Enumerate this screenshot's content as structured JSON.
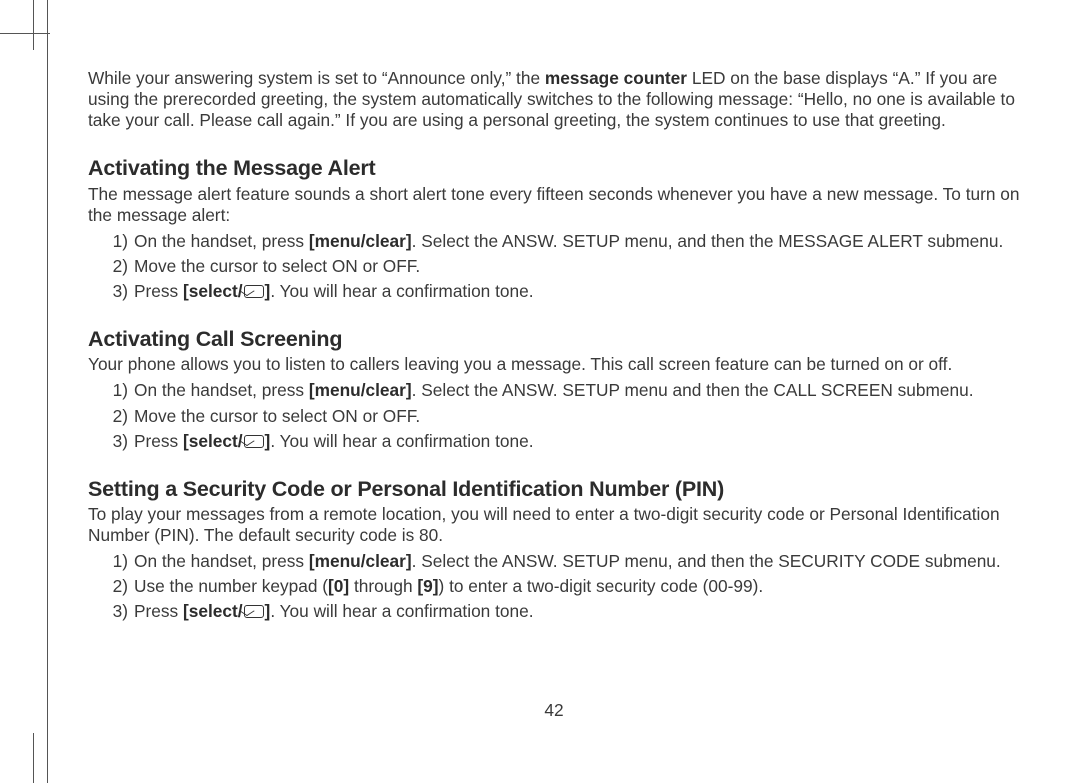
{
  "intro": {
    "p1_a": "While your answering system is set to “Announce only,” the ",
    "p1_bold": "message counter",
    "p1_b": " LED on the base displays “A.” If you are using the prerecorded greeting, the system automatically switches to the following message: “Hello, no one is available to take your call. Please call again.” If you are using a personal greeting, the system continues to use that greeting."
  },
  "sec1": {
    "heading": "Activating the Message Alert",
    "p": "The message alert feature sounds a short alert tone every fifteen seconds whenever you have a new message. To turn on the message alert:",
    "steps": [
      {
        "n": "1)",
        "a": "On the handset, press ",
        "b": "[menu/clear]",
        "c": ". Select the ANSW. SETUP menu, and then the MESSAGE ALERT submenu."
      },
      {
        "n": "2)",
        "a": "Move the cursor to select ON or OFF.",
        "b": "",
        "c": ""
      },
      {
        "n": "3)",
        "a": "Press ",
        "b": "[select/",
        "c": "]",
        "d": ". You will hear a confirmation tone."
      }
    ]
  },
  "sec2": {
    "heading": "Activating Call Screening",
    "p": "Your phone allows you to listen to callers leaving you a message. This call screen feature can be turned on or off.",
    "steps": [
      {
        "n": "1)",
        "a": "On the handset, press ",
        "b": "[menu/clear]",
        "c": ". Select the ANSW. SETUP menu and then the CALL SCREEN submenu."
      },
      {
        "n": "2)",
        "a": "Move the cursor to select ON or OFF.",
        "b": "",
        "c": ""
      },
      {
        "n": "3)",
        "a": "Press ",
        "b": "[select/",
        "c": "]",
        "d": ". You will hear a confirmation tone."
      }
    ]
  },
  "sec3": {
    "heading": "Setting a Security Code or Personal Identification Number (PIN)",
    "p": "To play your messages from a remote location, you will need to enter a two-digit security code or Personal Identification Number (PIN). The default security code is 80.",
    "steps": [
      {
        "n": "1)",
        "a": "On the handset, press ",
        "b": "[menu/clear]",
        "c": ". Select the ANSW. SETUP menu, and then the SECURITY CODE submenu."
      },
      {
        "n": "2)",
        "a": "Use the number keypad (",
        "b": "[0]",
        "c": " through ",
        "d": "[9]",
        "e": ") to enter a two-digit security code (00-99)."
      },
      {
        "n": "3)",
        "a": "Press ",
        "b": "[select/",
        "c": "]",
        "d": ". You will hear a confirmation tone."
      }
    ]
  },
  "page_number": "42"
}
